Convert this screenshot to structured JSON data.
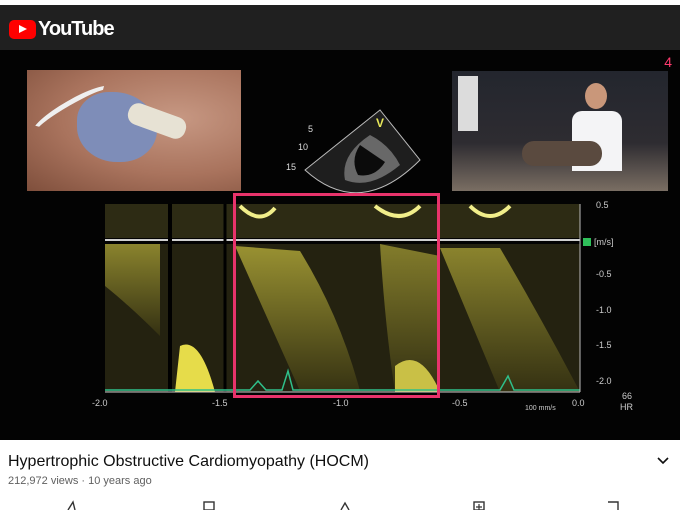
{
  "header": {
    "logo_text": "YouTube",
    "logo_color": "#ff0000"
  },
  "video": {
    "slide_number": "4",
    "echo_label_v": "V",
    "echo_depth_labels": [
      "5",
      "10",
      "15"
    ],
    "doppler": {
      "x_ticks": [
        "-2.0",
        "-1.5",
        "-1.0",
        "-0.5",
        "0.0"
      ],
      "y_ticks": [
        "0.5",
        "[m/s]",
        "-0.5",
        "-1.0",
        "-1.5",
        "-2.0"
      ],
      "right_label_top": "66",
      "right_label_bottom": "HR",
      "speed_label": "100 mm/s"
    },
    "highlight_color": "#e8336b"
  },
  "info": {
    "title": "Hypertrophic Obstructive Cardiomyopathy (HOCM)",
    "meta": "212,972 views · 10 years ago"
  },
  "icons": [
    "youtube-logo-icon",
    "chevron-down-icon",
    "like-icon",
    "share-icon",
    "remix-icon",
    "add-icon",
    "download-icon"
  ]
}
